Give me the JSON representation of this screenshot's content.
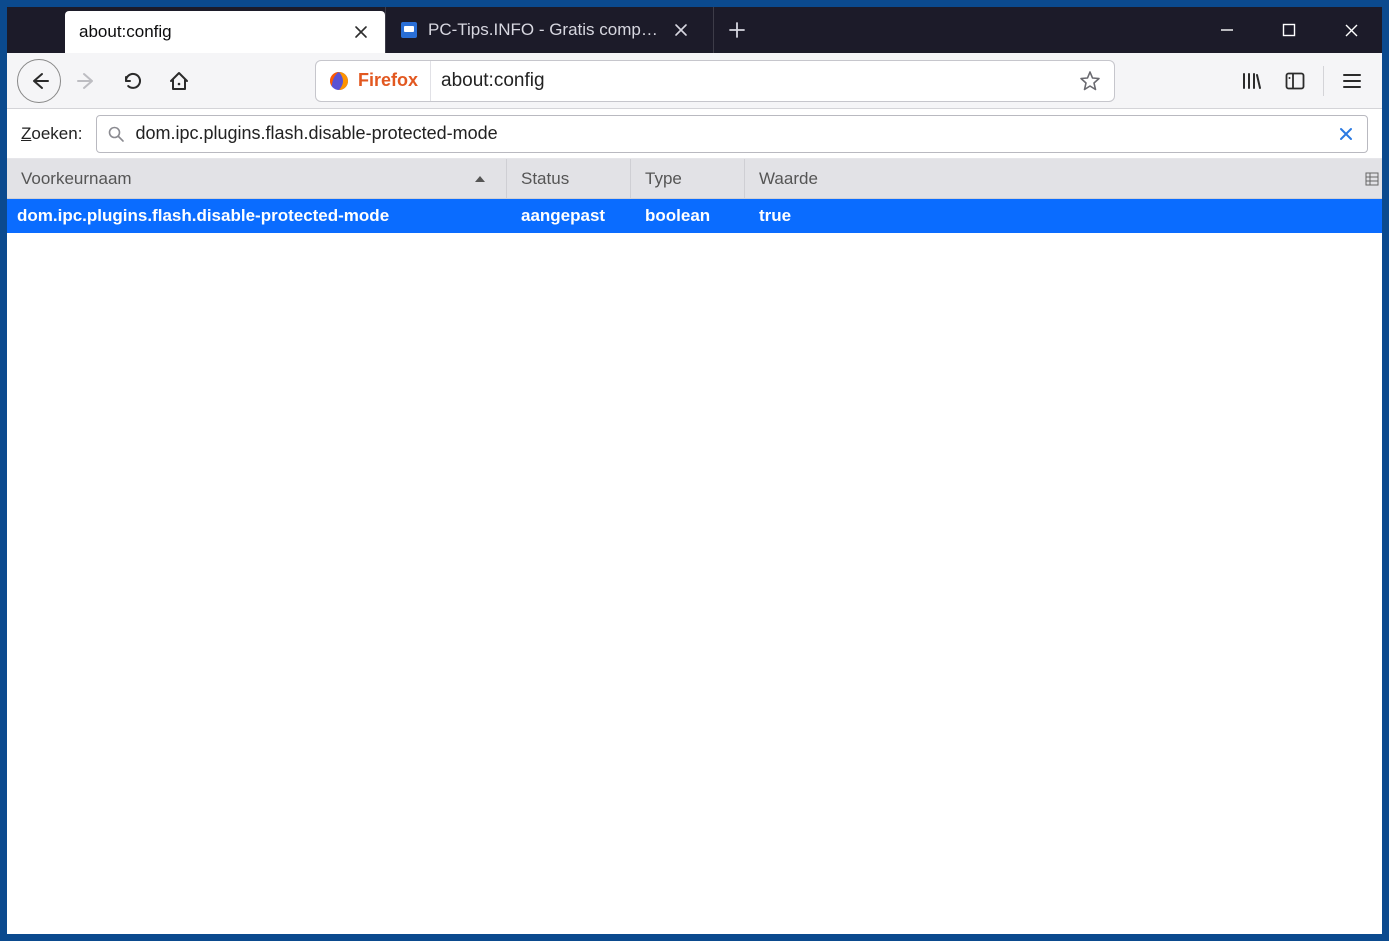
{
  "tabs": [
    {
      "title": "about:config",
      "active": true
    },
    {
      "title": "PC-Tips.INFO - Gratis compute",
      "active": false
    }
  ],
  "identity_label": "Firefox",
  "address": "about:config",
  "search_label_first": "Z",
  "search_label_rest": "oeken:",
  "search_value": "dom.ipc.plugins.flash.disable-protected-mode",
  "columns": {
    "name": "Voorkeurnaam",
    "status": "Status",
    "type": "Type",
    "value": "Waarde"
  },
  "rows": [
    {
      "name": "dom.ipc.plugins.flash.disable-protected-mode",
      "status": "aangepast",
      "type": "boolean",
      "value": "true"
    }
  ]
}
